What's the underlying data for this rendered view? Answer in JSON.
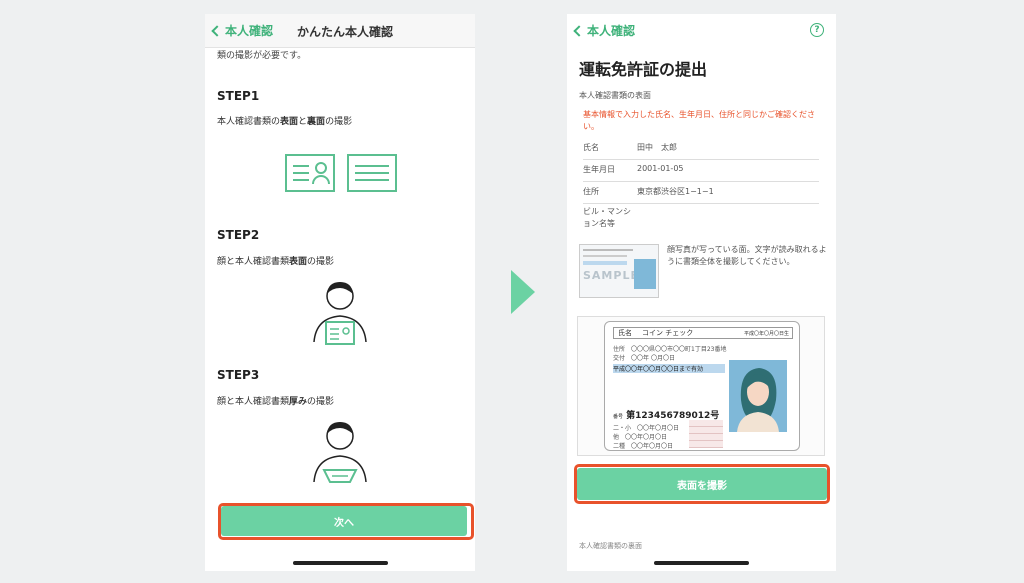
{
  "left": {
    "nav": {
      "back_label": "本人確認",
      "title": "かんたん本人確認"
    },
    "intro": "類の撮影が必要です。",
    "steps": [
      {
        "heading": "STEP1",
        "desc_pre": "本人確認書類の",
        "desc_bold1": "表面",
        "desc_mid": "と",
        "desc_bold2": "裏面",
        "desc_post": "の撮影"
      },
      {
        "heading": "STEP2",
        "desc_pre": "顔と本人確認書類",
        "desc_bold1": "表面",
        "desc_post": "の撮影"
      },
      {
        "heading": "STEP3",
        "desc_pre": "顔と本人確認書類",
        "desc_bold1": "厚み",
        "desc_post": "の撮影"
      }
    ],
    "next_button": "次へ"
  },
  "right": {
    "nav": {
      "back_label": "本人確認",
      "help": "?"
    },
    "title": "運転免許証の提出",
    "subtitle": "本人確認書類の表面",
    "warning": "基本情報で入力した氏名、生年月日、住所と同じかご確認ください。",
    "info": [
      {
        "key": "氏名",
        "value": "田中　太郎"
      },
      {
        "key": "生年月日",
        "value": "2001-01-05"
      },
      {
        "key": "住所",
        "value": "東京都渋谷区1−1−1"
      },
      {
        "key": "ビル・マンション名等",
        "value": ""
      }
    ],
    "sample_text": "SAMPLE",
    "sample_desc": "顔写真が写っている面。文字が読み取れるように書類全体を撮影してください。",
    "license": {
      "name_label": "氏名",
      "name_value": "コイン チェック",
      "birth": "平成〇年〇月〇日生",
      "address_label": "住所",
      "address_value": "〇〇〇県〇〇市〇〇町1丁目23番地",
      "issue_label": "交付",
      "issue_value": "〇〇年 〇月〇日",
      "valid": "平成〇〇年〇〇月〇〇日まで有効",
      "number_label": "番号",
      "number": "第123456789012号",
      "rows": [
        "二・小",
        "他",
        "二種"
      ],
      "row_value": "〇〇年〇月〇日"
    },
    "shoot_button": "表面を撮影",
    "footer": "本人確認書類の裏面"
  },
  "colors": {
    "accent": "#6bd2a3",
    "link": "#3fb27a",
    "highlight": "#e8522b",
    "warning": "#e8522b"
  }
}
